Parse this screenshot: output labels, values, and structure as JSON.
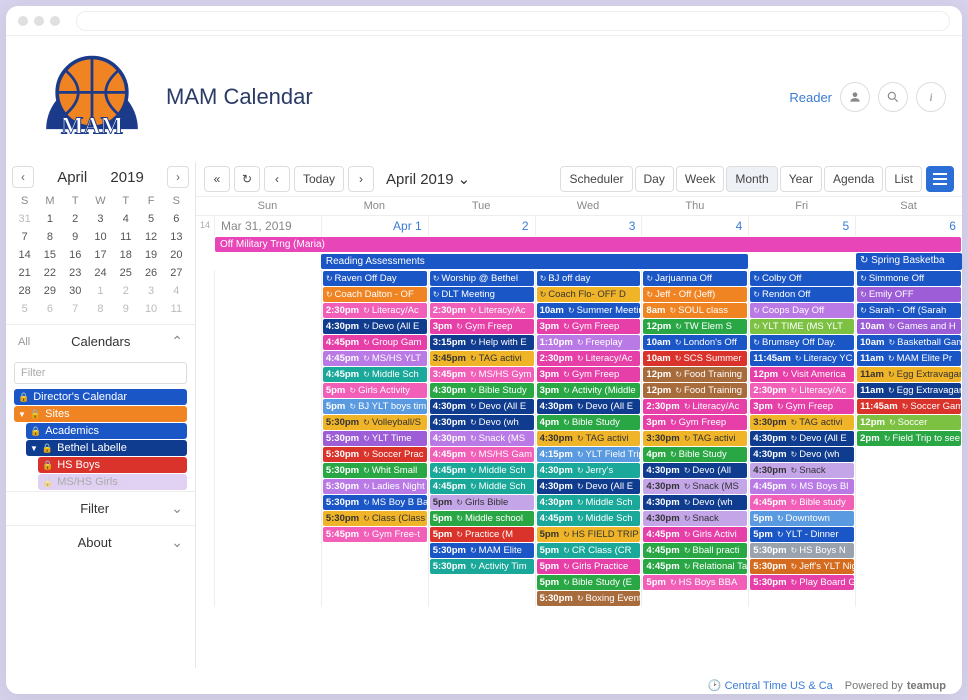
{
  "page": {
    "title": "MAM Calendar",
    "reader": "Reader"
  },
  "mini": {
    "month": "April",
    "year": "2019",
    "dow": [
      "S",
      "M",
      "T",
      "W",
      "T",
      "F",
      "S"
    ],
    "days": [
      {
        "n": "31",
        "muted": true
      },
      {
        "n": "1"
      },
      {
        "n": "2"
      },
      {
        "n": "3"
      },
      {
        "n": "4"
      },
      {
        "n": "5"
      },
      {
        "n": "6"
      },
      {
        "n": "7"
      },
      {
        "n": "8"
      },
      {
        "n": "9"
      },
      {
        "n": "10"
      },
      {
        "n": "11"
      },
      {
        "n": "12"
      },
      {
        "n": "13"
      },
      {
        "n": "14"
      },
      {
        "n": "15"
      },
      {
        "n": "16"
      },
      {
        "n": "17"
      },
      {
        "n": "18"
      },
      {
        "n": "19"
      },
      {
        "n": "20"
      },
      {
        "n": "21"
      },
      {
        "n": "22"
      },
      {
        "n": "23"
      },
      {
        "n": "24"
      },
      {
        "n": "25"
      },
      {
        "n": "26"
      },
      {
        "n": "27"
      },
      {
        "n": "28"
      },
      {
        "n": "29"
      },
      {
        "n": "30"
      },
      {
        "n": "1",
        "muted": true
      },
      {
        "n": "2",
        "muted": true
      },
      {
        "n": "3",
        "muted": true
      },
      {
        "n": "4",
        "muted": true
      },
      {
        "n": "5",
        "muted": true
      },
      {
        "n": "6",
        "muted": true
      },
      {
        "n": "7",
        "muted": true
      },
      {
        "n": "8",
        "muted": true
      },
      {
        "n": "9",
        "muted": true
      },
      {
        "n": "10",
        "muted": true
      },
      {
        "n": "11",
        "muted": true
      }
    ]
  },
  "sidebar": {
    "all": "All",
    "calendars": "Calendars",
    "filter_ph": "Filter",
    "filter": "Filter",
    "about": "About",
    "items": [
      {
        "label": "Director's Calendar",
        "color": "#1b56c7",
        "lock": true
      },
      {
        "label": "Sites",
        "color": "#f08423",
        "tri": true,
        "lock": true
      },
      {
        "label": "Academics",
        "color": "#1b56c7",
        "inset": 1,
        "lock": true
      },
      {
        "label": "Bethel Labelle",
        "color": "#0f3c8f",
        "inset": 1,
        "tri": true,
        "lock": true
      },
      {
        "label": "HS Boys",
        "color": "#d9332b",
        "inset": 2,
        "lock": true
      },
      {
        "label": "MS/HS Girls",
        "color": "#c3a5e8",
        "inset": 2,
        "lock": true,
        "muted": true
      }
    ]
  },
  "toolbar": {
    "today": "Today",
    "range": "April 2019",
    "views": [
      "Scheduler",
      "Day",
      "Week",
      "Month",
      "Year",
      "Agenda",
      "List"
    ],
    "active": "Month"
  },
  "grid": {
    "dow": [
      "Sun",
      "Mon",
      "Tue",
      "Wed",
      "Thu",
      "Fri",
      "Sat"
    ],
    "week": "14",
    "dates": [
      "Mar 31, 2019",
      "Apr 1",
      "2",
      "3",
      "4",
      "5",
      "6"
    ],
    "allday": {
      "military": "Off Military Trng (Maria)",
      "reading": "Reading Assessments",
      "spring": "Spring Basketba"
    }
  },
  "events": {
    "mon": [
      {
        "c": "blue",
        "t": "Raven Off Day"
      },
      {
        "c": "orange",
        "t": "Coach Dalton - OF"
      },
      {
        "c": "pink",
        "tm": "2:30pm",
        "t": "Literacy/Ac"
      },
      {
        "c": "navy",
        "tm": "4:30pm",
        "t": "Devo (All E"
      },
      {
        "c": "hotpink",
        "tm": "4:45pm",
        "t": "Group Gam"
      },
      {
        "c": "violet",
        "tm": "4:45pm",
        "t": "MS/HS YLT"
      },
      {
        "c": "teal",
        "tm": "4:45pm",
        "t": "Middle Sch"
      },
      {
        "c": "pink",
        "tm": "5pm",
        "t": "Girls Activity"
      },
      {
        "c": "ltblue",
        "tm": "5pm",
        "t": "BJ YLT boys tim"
      },
      {
        "c": "gold",
        "tm": "5:30pm",
        "t": "Volleyball/S"
      },
      {
        "c": "purple",
        "tm": "5:30pm",
        "t": "YLT Time"
      },
      {
        "c": "red",
        "tm": "5:30pm",
        "t": "Soccer Prac"
      },
      {
        "c": "green",
        "tm": "5:30pm",
        "t": "Whit Small"
      },
      {
        "c": "violet",
        "tm": "5:30pm",
        "t": "Ladies Night"
      },
      {
        "c": "blue",
        "tm": "5:30pm",
        "t": "MS Boy B Bal"
      },
      {
        "c": "gold",
        "tm": "5:30pm",
        "t": "Class (Class"
      },
      {
        "c": "pink",
        "tm": "5:45pm",
        "t": "Gym Free-t"
      }
    ],
    "tue": [
      {
        "c": "blue",
        "t": "Worship @ Bethel"
      },
      {
        "c": "blue",
        "t": "DLT Meeting"
      },
      {
        "c": "pink",
        "tm": "2:30pm",
        "t": "Literacy/Ac"
      },
      {
        "c": "hotpink",
        "tm": "3pm",
        "t": "Gym Freep"
      },
      {
        "c": "navy",
        "tm": "3:15pm",
        "t": "Help with E"
      },
      {
        "c": "gold",
        "tm": "3:45pm",
        "t": "TAG activi"
      },
      {
        "c": "pink",
        "tm": "3:45pm",
        "t": "MS/HS Gym"
      },
      {
        "c": "green",
        "tm": "4:30pm",
        "t": "Bible Study"
      },
      {
        "c": "navy",
        "tm": "4:30pm",
        "t": "Devo (All E"
      },
      {
        "c": "navy",
        "tm": "4:30pm",
        "t": "Devo (wh"
      },
      {
        "c": "violet",
        "tm": "4:30pm",
        "t": "Snack (MS"
      },
      {
        "c": "pink",
        "tm": "4:45pm",
        "t": "MS/HS Gam"
      },
      {
        "c": "teal",
        "tm": "4:45pm",
        "t": "Middle Sch"
      },
      {
        "c": "teal",
        "tm": "4:45pm",
        "t": "Middle Sch"
      },
      {
        "c": "ltpurple",
        "tm": "5pm",
        "t": "Girls Bible"
      },
      {
        "c": "green",
        "tm": "5pm",
        "t": "Middle school"
      },
      {
        "c": "red",
        "tm": "5pm",
        "t": "Practice (M"
      },
      {
        "c": "blue",
        "tm": "5:30pm",
        "t": "MAM Elite"
      },
      {
        "c": "teal",
        "tm": "5:30pm",
        "t": "Activity Tim"
      }
    ],
    "wed": [
      {
        "c": "blue",
        "t": "BJ off day"
      },
      {
        "c": "gold",
        "t": "Coach Flo- OFF D"
      },
      {
        "c": "blue",
        "tm": "10am",
        "t": "Summer Meetin"
      },
      {
        "c": "hotpink",
        "tm": "3pm",
        "t": "Gym Freep"
      },
      {
        "c": "violet",
        "tm": "1:10pm",
        "t": "Freeplay"
      },
      {
        "c": "hotpink",
        "tm": "2:30pm",
        "t": "Literacy/Ac"
      },
      {
        "c": "hotpink",
        "tm": "3pm",
        "t": "Gym Freep"
      },
      {
        "c": "green",
        "tm": "3pm",
        "t": "Activity (Middle"
      },
      {
        "c": "navy",
        "tm": "4:30pm",
        "t": "Devo (All E"
      },
      {
        "c": "green",
        "tm": "4pm",
        "t": "Bible Study"
      },
      {
        "c": "gold",
        "tm": "4:30pm",
        "t": "TAG activi"
      },
      {
        "c": "ltblue",
        "tm": "4:15pm",
        "t": "YLT Field Trip"
      },
      {
        "c": "teal",
        "tm": "4:30pm",
        "t": "Jerry's"
      },
      {
        "c": "navy",
        "tm": "4:30pm",
        "t": "Devo (All E"
      },
      {
        "c": "teal",
        "tm": "4:30pm",
        "t": "Middle Sch"
      },
      {
        "c": "teal",
        "tm": "4:45pm",
        "t": "Middle Sch"
      },
      {
        "c": "gold",
        "tm": "5pm",
        "t": "HS FIELD TRIP"
      },
      {
        "c": "teal",
        "tm": "5pm",
        "t": "CR Class (CR"
      },
      {
        "c": "hotpink",
        "tm": "5pm",
        "t": "Girls Practice"
      },
      {
        "c": "green",
        "tm": "5pm",
        "t": "Bible Study (E"
      },
      {
        "c": "brown",
        "tm": "5:30pm",
        "t": "Boxing Event"
      }
    ],
    "thu": [
      {
        "c": "blue",
        "t": "Jarjuanna Off"
      },
      {
        "c": "orange",
        "t": "Jeff - Off (Jeff)"
      },
      {
        "c": "orange",
        "tm": "8am",
        "t": "SOUL class"
      },
      {
        "c": "green",
        "tm": "12pm",
        "t": "TW Elem S"
      },
      {
        "c": "blue",
        "tm": "10am",
        "t": "London's Off"
      },
      {
        "c": "red",
        "tm": "10am",
        "t": "SCS Summer"
      },
      {
        "c": "brown",
        "tm": "12pm",
        "t": "Food Training"
      },
      {
        "c": "brown",
        "tm": "12pm",
        "t": "Food Training"
      },
      {
        "c": "hotpink",
        "tm": "2:30pm",
        "t": "Literacy/Ac"
      },
      {
        "c": "hotpink",
        "tm": "3pm",
        "t": "Gym Freep"
      },
      {
        "c": "gold",
        "tm": "3:30pm",
        "t": "TAG activi"
      },
      {
        "c": "green",
        "tm": "4pm",
        "t": "Bible Study"
      },
      {
        "c": "navy",
        "tm": "4:30pm",
        "t": "Devo (All"
      },
      {
        "c": "ltpurple",
        "tm": "4:30pm",
        "t": "Snack (MS"
      },
      {
        "c": "navy",
        "tm": "4:30pm",
        "t": "Devo (wh"
      },
      {
        "c": "ltpurple",
        "tm": "4:30pm",
        "t": "Snack"
      },
      {
        "c": "hotpink",
        "tm": "4:45pm",
        "t": "Girls Activi"
      },
      {
        "c": "green",
        "tm": "4:45pm",
        "t": "Bball practi"
      },
      {
        "c": "green",
        "tm": "4:45pm",
        "t": "Relational Tal"
      },
      {
        "c": "pink",
        "tm": "5pm",
        "t": "HS Boys BBA"
      }
    ],
    "fri": [
      {
        "c": "blue",
        "t": "Colby Off"
      },
      {
        "c": "blue",
        "t": "Rendon Off"
      },
      {
        "c": "violet",
        "t": "Coops Day Off"
      },
      {
        "c": "lime",
        "t": "YLT TIME (MS YLT"
      },
      {
        "c": "blue",
        "t": "Brumsey Off Day."
      },
      {
        "c": "blue",
        "tm": "11:45am",
        "t": "Literacy YC N"
      },
      {
        "c": "hotpink",
        "tm": "12pm",
        "t": "Visit America"
      },
      {
        "c": "pink",
        "tm": "2:30pm",
        "t": "Literacy/Ac"
      },
      {
        "c": "hotpink",
        "tm": "3pm",
        "t": "Gym Freep"
      },
      {
        "c": "gold",
        "tm": "3:30pm",
        "t": "TAG activi"
      },
      {
        "c": "navy",
        "tm": "4:30pm",
        "t": "Devo (All E"
      },
      {
        "c": "navy",
        "tm": "4:30pm",
        "t": "Devo (wh"
      },
      {
        "c": "ltpurple",
        "tm": "4:30pm",
        "t": "Snack"
      },
      {
        "c": "violet",
        "tm": "4:45pm",
        "t": "MS Boys Bl"
      },
      {
        "c": "pink",
        "tm": "4:45pm",
        "t": "Bible study"
      },
      {
        "c": "ltblue",
        "tm": "5pm",
        "t": "Downtown"
      },
      {
        "c": "blue",
        "tm": "5pm",
        "t": "YLT - Dinner"
      },
      {
        "c": "gray",
        "tm": "5:30pm",
        "t": "HS Boys N"
      },
      {
        "c": "dkorange",
        "tm": "5:30pm",
        "t": "Jeff's YLT Nig"
      },
      {
        "c": "hotpink",
        "tm": "5:30pm",
        "t": "Play Board Ga"
      }
    ],
    "sat": [
      {
        "c": "blue",
        "t": "Simmone Off"
      },
      {
        "c": "purple",
        "t": "Emily OFF"
      },
      {
        "c": "blue",
        "t": "Sarah - Off (Sarah"
      },
      {
        "c": "purple",
        "tm": "10am",
        "t": "Games and H"
      },
      {
        "c": "blue",
        "tm": "10am",
        "t": "Basketball Gam"
      },
      {
        "c": "blue",
        "tm": "11am",
        "t": "MAM Elite Pr"
      },
      {
        "c": "gold",
        "tm": "11am",
        "t": "Egg Extravagan"
      },
      {
        "c": "navy",
        "tm": "11am",
        "t": "Egg Extravagan"
      },
      {
        "c": "red",
        "tm": "11:45am",
        "t": "Soccer Gam"
      },
      {
        "c": "lime",
        "tm": "12pm",
        "t": "Soccer"
      },
      {
        "c": "green",
        "tm": "2pm",
        "t": "Field Trip to see"
      }
    ]
  },
  "footer": {
    "tz": "Central Time US & Ca",
    "powered": "Powered by",
    "brand": "teamup"
  }
}
